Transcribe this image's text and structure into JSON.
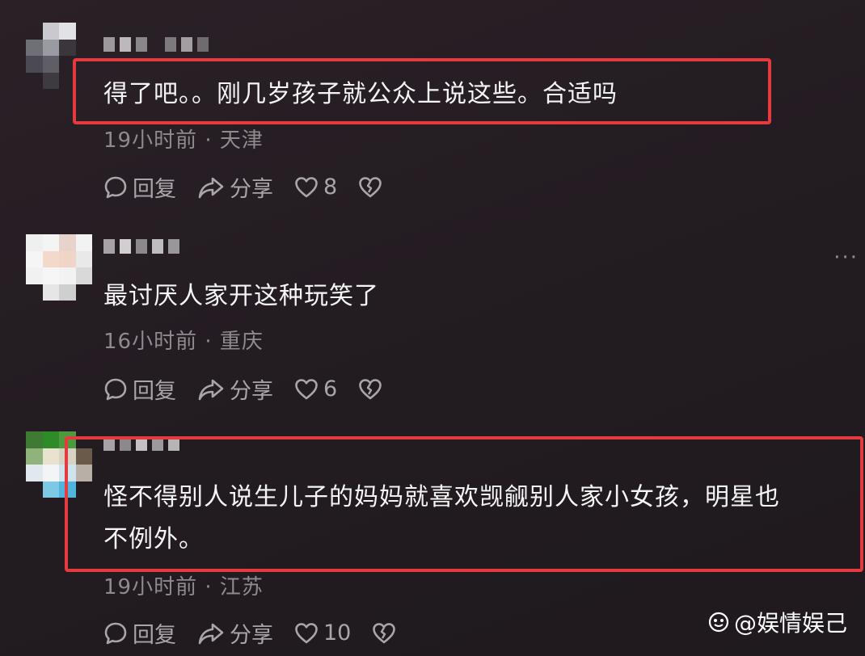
{
  "comments": [
    {
      "text": "得了吧。。刚几岁孩子就公众上说这些。合适吗",
      "meta": "19小时前 · 天津",
      "reply_label": "回复",
      "share_label": "分享",
      "likes": "8"
    },
    {
      "text": "最讨厌人家开这种玩笑了",
      "meta": "16小时前 · 重庆",
      "reply_label": "回复",
      "share_label": "分享",
      "likes": "6",
      "more": "···"
    },
    {
      "text_line1": "怪不得别人说生儿子的妈妈就喜欢觊觎别人家小女孩，明星也",
      "text_line2": "不例外。",
      "meta": "19小时前 · 江苏",
      "reply_label": "回复",
      "share_label": "分享",
      "likes": "10"
    }
  ],
  "watermark": "@娱情娱己",
  "colors": {
    "background": "#231c21",
    "highlight_border": "#e53b3f",
    "meta_text": "#8e8a8d",
    "action_text": "#a9a5a8"
  },
  "icons": [
    "reply-icon",
    "share-icon",
    "like-heart-icon",
    "dislike-broken-heart-icon",
    "watermark-logo-icon"
  ]
}
